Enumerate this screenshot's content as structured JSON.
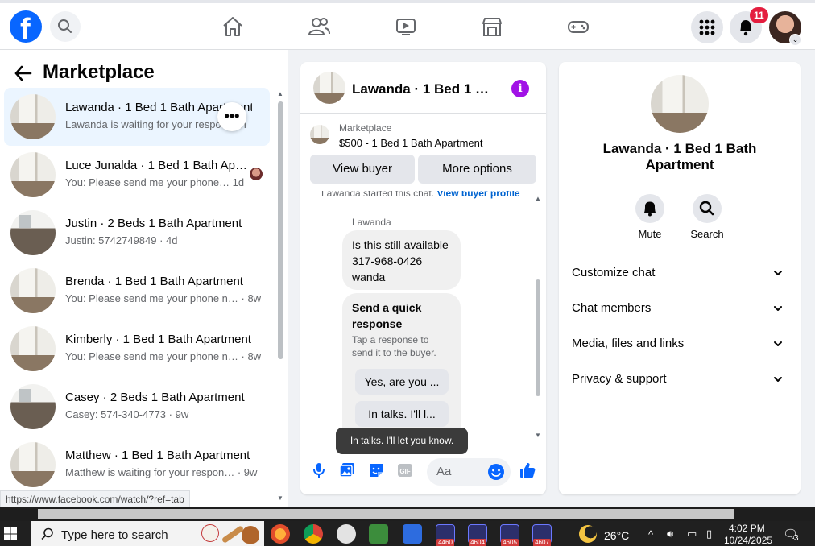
{
  "sidebar": {
    "title": "Marketplace",
    "chats": [
      {
        "name": "Lawanda · 1 Bed 1 Bath Apartment",
        "preview": "Lawanda is waiting for your respo… 6h",
        "thumb": "bright",
        "active": true
      },
      {
        "name": "Luce Junalda · 1 Bed 1 Bath Ap…",
        "preview": "You: Please send me your phone… 1d",
        "thumb": "bright"
      },
      {
        "name": "Justin · 2 Beds 1 Bath Apartment",
        "preview": "Justin: 5742749849 · 4d",
        "thumb": "dark"
      },
      {
        "name": "Brenda · 1 Bed 1 Bath Apartment",
        "preview": "You: Please send me your phone n… · 8w",
        "thumb": "bright"
      },
      {
        "name": "Kimberly · 1 Bed 1 Bath Apartment",
        "preview": "You: Please send me your phone n… · 8w",
        "thumb": "bright"
      },
      {
        "name": "Casey · 2 Beds 1 Bath Apartment",
        "preview": "Casey: 574-340-4773 · 9w",
        "thumb": "dark"
      },
      {
        "name": "Matthew · 1 Bed 1 Bath Apartment",
        "preview": "Matthew is waiting for your respon… · 9w",
        "thumb": "bright"
      }
    ],
    "more_symbol": "•••",
    "status_url": "https://www.facebook.com/watch/?ref=tab"
  },
  "topbar": {
    "notification_count": "11",
    "logo_letter": "f"
  },
  "chat": {
    "title": "Lawanda · 1 Bed 1 Bath Apartment",
    "info_symbol": "i",
    "listing_label": "Marketplace",
    "listing_price": "$500 - 1 Bed 1 Bath Apartment",
    "view_buyer": "View buyer",
    "more_options": "More options",
    "started_text": "Lawanda started this chat.",
    "started_link": "View buyer profile",
    "sender": "Lawanda",
    "message": "Is this still available 317-968-0426 wanda",
    "quick_title": "Send a quick response",
    "quick_sub": "Tap a response to send it to the buyer.",
    "reply_1": "Yes, are you ...",
    "reply_2": "In talks. I'll l...",
    "tooltip": "In talks. I'll let you know.",
    "composer_placeholder": "Aa"
  },
  "info": {
    "name": "Lawanda · 1 Bed 1 Bath Apartment",
    "mute": "Mute",
    "search": "Search",
    "sections": [
      "Customize chat",
      "Chat members",
      "Media, files and links",
      "Privacy & support"
    ]
  },
  "taskbar": {
    "search_placeholder": "Type here to search",
    "badges": [
      "4460",
      "4604",
      "4605",
      "4607"
    ],
    "temperature": "26°C",
    "time": "4:02 PM",
    "date": "10/24/2025",
    "notif_count": "3"
  },
  "colors": {
    "brand": "#0866ff",
    "messenger_purple": "#a112e6",
    "active_row": "#ebf5ff",
    "badge_red": "#e41e3f"
  }
}
